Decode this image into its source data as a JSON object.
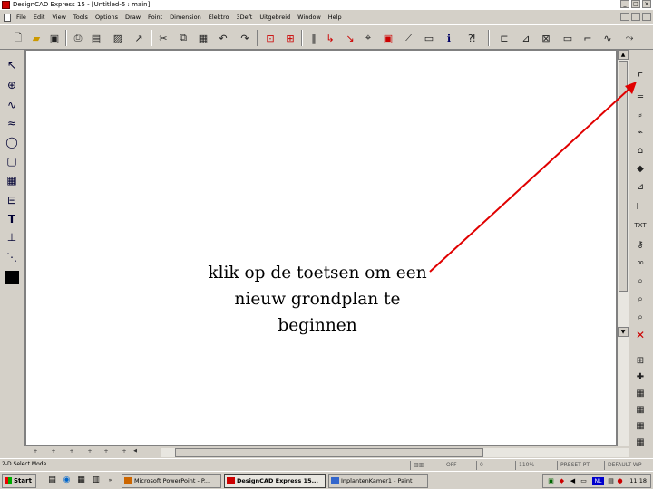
{
  "window": {
    "title": "DesignCAD Express 15 - [Untitled-5 : main]"
  },
  "menu": {
    "items": [
      "File",
      "Edit",
      "View",
      "Tools",
      "Options",
      "Draw",
      "Point",
      "Dimension",
      "Elektro",
      "3Deft",
      "Uitgebreid",
      "Window",
      "Help"
    ]
  },
  "annotation": {
    "line1": "klik op de toetsen om een",
    "line2": "nieuw grondplan te",
    "line3": "beginnen"
  },
  "status": {
    "mode": "2-D Select Mode",
    "off": "OFF",
    "zero": "0",
    "zoom": "110%",
    "preset": "PRESET PT",
    "default": "DEFAULT WP"
  },
  "taskbar": {
    "start": "Start",
    "tasks": [
      "Microsoft PowerPoint - P...",
      "DesignCAD Express 15...",
      "InplantenKamer1 - Paint"
    ],
    "lang": "NL",
    "clock": "11:18"
  },
  "colors": {
    "arrow": "#e00000",
    "canvas": "#ffffff",
    "chrome": "#d4d0c8"
  }
}
